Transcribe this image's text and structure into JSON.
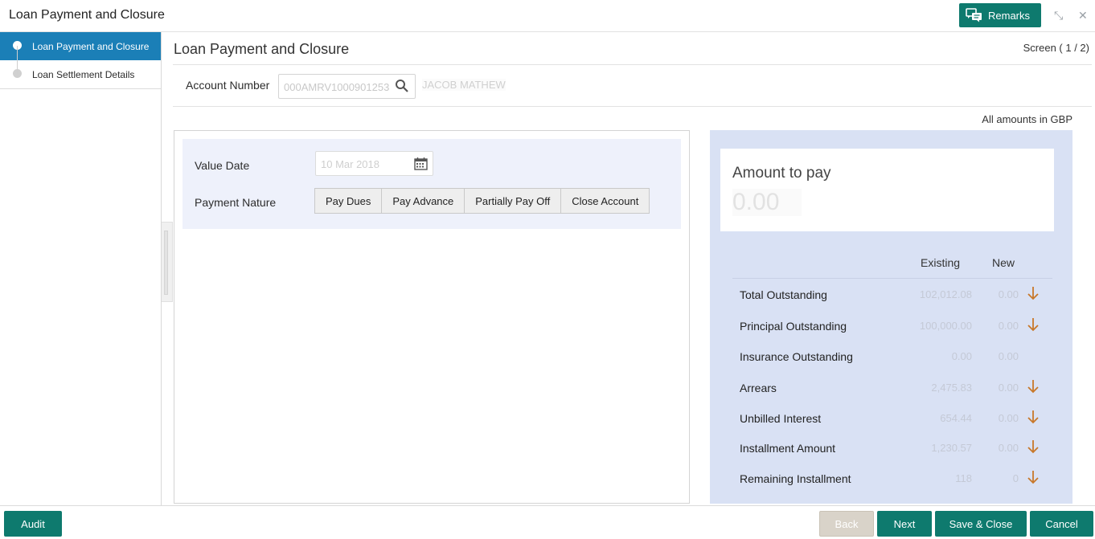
{
  "window": {
    "title": "Loan Payment and Closure",
    "remarks_label": "Remarks"
  },
  "sidebar": {
    "steps": [
      {
        "label": "Loan Payment and Closure",
        "active": true
      },
      {
        "label": "Loan Settlement Details",
        "active": false
      }
    ]
  },
  "main": {
    "title": "Loan Payment and Closure",
    "screen_count": "Screen ( 1 / 2)",
    "account_label": "Account Number",
    "account_value": "000AMRV1000901253",
    "account_name": "JACOB MATHEW",
    "amounts_note": "All amounts in GBP"
  },
  "form": {
    "value_date_label": "Value Date",
    "value_date": "10 Mar 2018",
    "payment_nature_label": "Payment Nature",
    "payment_options": [
      "Pay Dues",
      "Pay Advance",
      "Partially Pay Off",
      "Close Account"
    ]
  },
  "summary": {
    "amount_to_pay_label": "Amount to pay",
    "amount_to_pay": "0.00",
    "col_existing": "Existing",
    "col_new": "New",
    "rows": [
      {
        "label": "Total Outstanding",
        "existing": "102,012.08",
        "new": "0.00",
        "arrow": true
      },
      {
        "label": "Principal Outstanding",
        "existing": "100,000.00",
        "new": "0.00",
        "arrow": true
      },
      {
        "label": "Insurance Outstanding",
        "existing": "0.00",
        "new": "0.00",
        "arrow": false
      },
      {
        "label": "Arrears",
        "existing": "2,475.83",
        "new": "0.00",
        "arrow": true
      },
      {
        "label": "Unbilled Interest",
        "existing": "654.44",
        "new": "0.00",
        "arrow": true
      },
      {
        "label": "Installment Amount",
        "existing": "1,230.57",
        "new": "0.00",
        "arrow": true
      },
      {
        "label": "Remaining Installment",
        "existing": "118",
        "new": "0",
        "arrow": true
      }
    ]
  },
  "footer": {
    "audit": "Audit",
    "back": "Back",
    "next": "Next",
    "save_close": "Save & Close",
    "cancel": "Cancel"
  },
  "colors": {
    "primary": "#0e7a6e",
    "sidebar_active": "#1b7fb7",
    "summary_bg": "#d9e1f4",
    "arrow": "#c8782a"
  },
  "icons": {
    "remarks": "chat-bubbles-icon",
    "account_search": "search-icon",
    "value_date": "calendar-icon",
    "row_arrow": "arrow-down-icon",
    "minimize": "collapse-icon",
    "close": "close-icon"
  }
}
